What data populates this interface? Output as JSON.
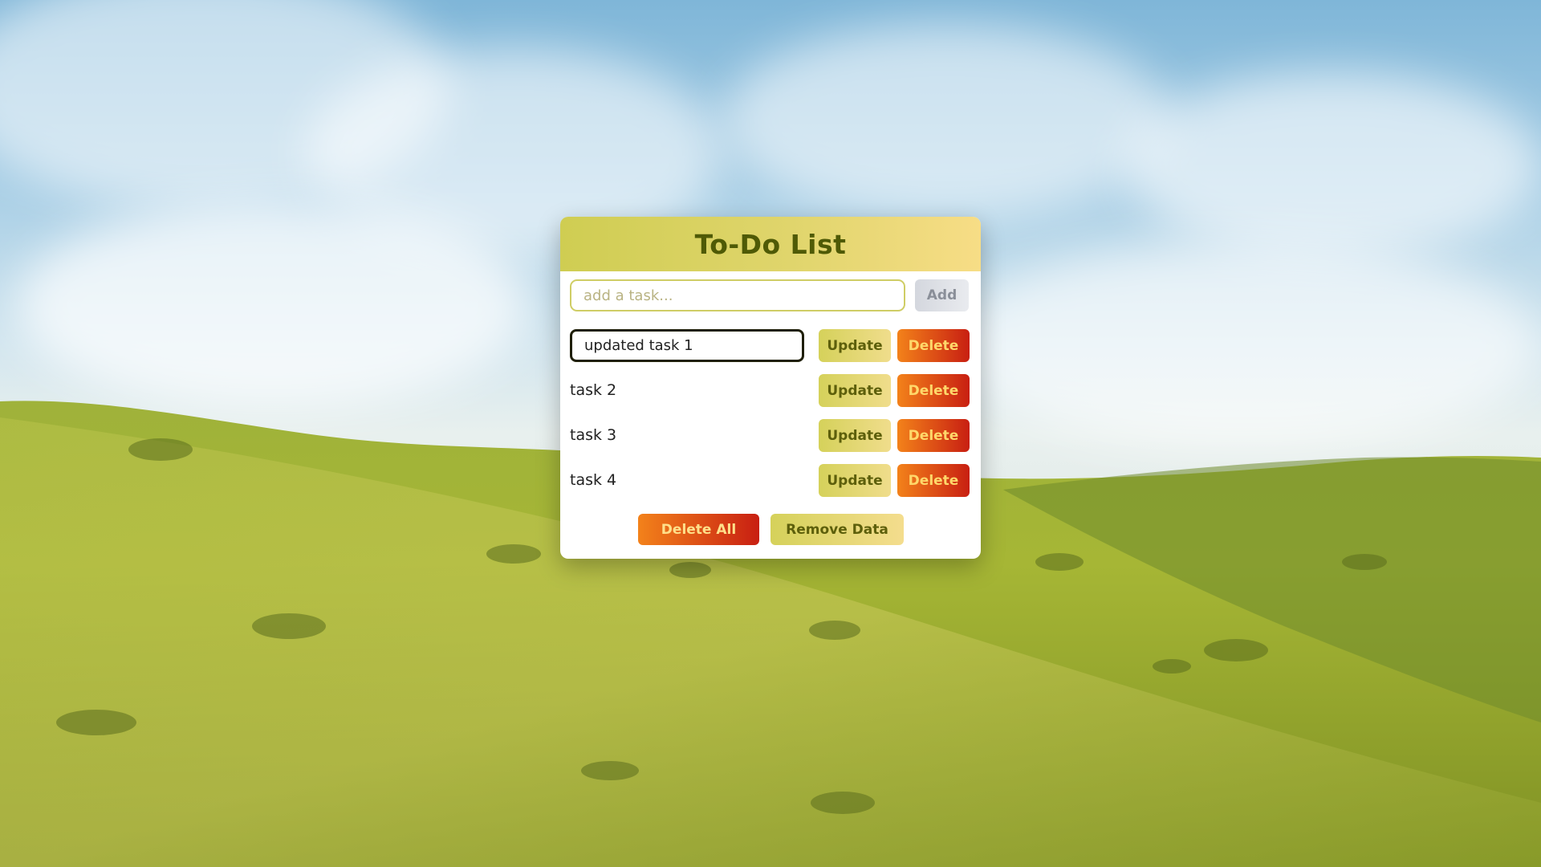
{
  "app": {
    "title": "To-Do List"
  },
  "new_task": {
    "placeholder": "add a task...",
    "value": "",
    "add_label": "Add"
  },
  "tasks": [
    {
      "text": "updated task 1",
      "editing": true,
      "update_label": "Update",
      "delete_label": "Delete"
    },
    {
      "text": "task 2",
      "editing": false,
      "update_label": "Update",
      "delete_label": "Delete"
    },
    {
      "text": "task 3",
      "editing": false,
      "update_label": "Update",
      "delete_label": "Delete"
    },
    {
      "text": "task 4",
      "editing": false,
      "update_label": "Update",
      "delete_label": "Delete"
    }
  ],
  "footer": {
    "delete_all_label": "Delete All",
    "remove_data_label": "Remove Data"
  },
  "colors": {
    "header_gradient_start": "#cfcd52",
    "header_gradient_end": "#f7dd86",
    "title_color": "#4f5a06",
    "delete_gradient_start": "#f3821a",
    "delete_gradient_end": "#c81f12",
    "update_gradient_start": "#d5d15a",
    "update_gradient_end": "#f0dd8c"
  }
}
